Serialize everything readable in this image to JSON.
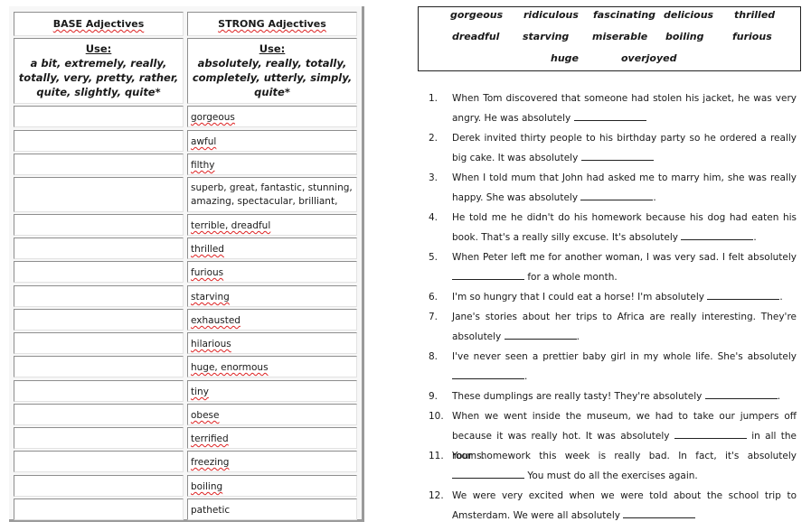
{
  "table": {
    "header_base": "BASE Adjectives",
    "header_strong": "STRONG Adjectives",
    "use_label_base": "Use:",
    "use_words_base": "a bit, extremely, really, totally, very, pretty, rather, quite, slightly, quite*",
    "use_label_strong": "Use:",
    "use_words_strong": "absolutely, really, totally, completely, utterly, simply, quite*",
    "rows": [
      {
        "base": "",
        "strong": "gorgeous"
      },
      {
        "base": "",
        "strong": "awful"
      },
      {
        "base": "",
        "strong": "filthy"
      },
      {
        "base": "",
        "strong": "superb, great, fantastic, stunning, amazing, spectacular, brilliant,"
      },
      {
        "base": "",
        "strong": "terrible, dreadful"
      },
      {
        "base": "",
        "strong": "thrilled"
      },
      {
        "base": "",
        "strong": "furious"
      },
      {
        "base": "",
        "strong": "starving"
      },
      {
        "base": "",
        "strong": "exhausted"
      },
      {
        "base": "",
        "strong": "hilarious"
      },
      {
        "base": "",
        "strong": "huge, enormous"
      },
      {
        "base": "",
        "strong": "tiny"
      },
      {
        "base": "",
        "strong": "obese"
      },
      {
        "base": "",
        "strong": "terrified"
      },
      {
        "base": "",
        "strong": "freezing"
      },
      {
        "base": "",
        "strong": "boiling"
      },
      {
        "base": "",
        "strong": "pathetic"
      }
    ]
  },
  "word_box": [
    "gorgeous",
    "ridiculous",
    "fascinating",
    "delicious",
    "thrilled",
    "dreadful",
    "starving",
    "miserable",
    "boiling",
    "furious",
    "huge",
    "overjoyed"
  ],
  "exercises": [
    {
      "num": "1.",
      "before": "When Tom discovered that someone had stolen his jacket, he was very angry. He was absolutely ",
      "after": ""
    },
    {
      "num": "2.",
      "before": "Derek invited thirty people to his birthday party so he ordered a really big cake. It was absolutely ",
      "after": ""
    },
    {
      "num": "3.",
      "before": "When I told mum that John had asked me to marry him, she was really happy. She was absolutely ",
      "after": "."
    },
    {
      "num": "4.",
      "before": "He told me he didn't do his homework because his dog had eaten his book. That's a really silly excuse. It's absolutely ",
      "after": "."
    },
    {
      "num": "5.",
      "before": "When Peter left me for another woman, I was very sad. I felt absolutely ",
      "after": " for a whole month."
    },
    {
      "num": "6.",
      "before": "I'm so hungry that I could eat a horse! I'm absolutely ",
      "after": "."
    },
    {
      "num": "7.",
      "before": "Jane's stories about her trips to Africa are really interesting. They're absolutely ",
      "after": "."
    },
    {
      "num": "8.",
      "before": "I've never seen a prettier baby girl in my whole life. She's absolutely ",
      "after": "."
    },
    {
      "num": "9.",
      "before": "These dumplings are really tasty! They're absolutely ",
      "after": "."
    },
    {
      "num": "10.",
      "before": "When we went inside the museum, we had to take our jumpers off because it was really hot. It was absolutely ",
      "after": " in all the rooms."
    },
    {
      "num": "11.",
      "before": "Your homework this week is really bad. In fact, it's absolutely ",
      "after": " You must do all the exercises again."
    },
    {
      "num": "12.",
      "before": "We were very excited when we were told about the school trip to Amsterdam. We were all absolutely ",
      "after": ""
    }
  ]
}
